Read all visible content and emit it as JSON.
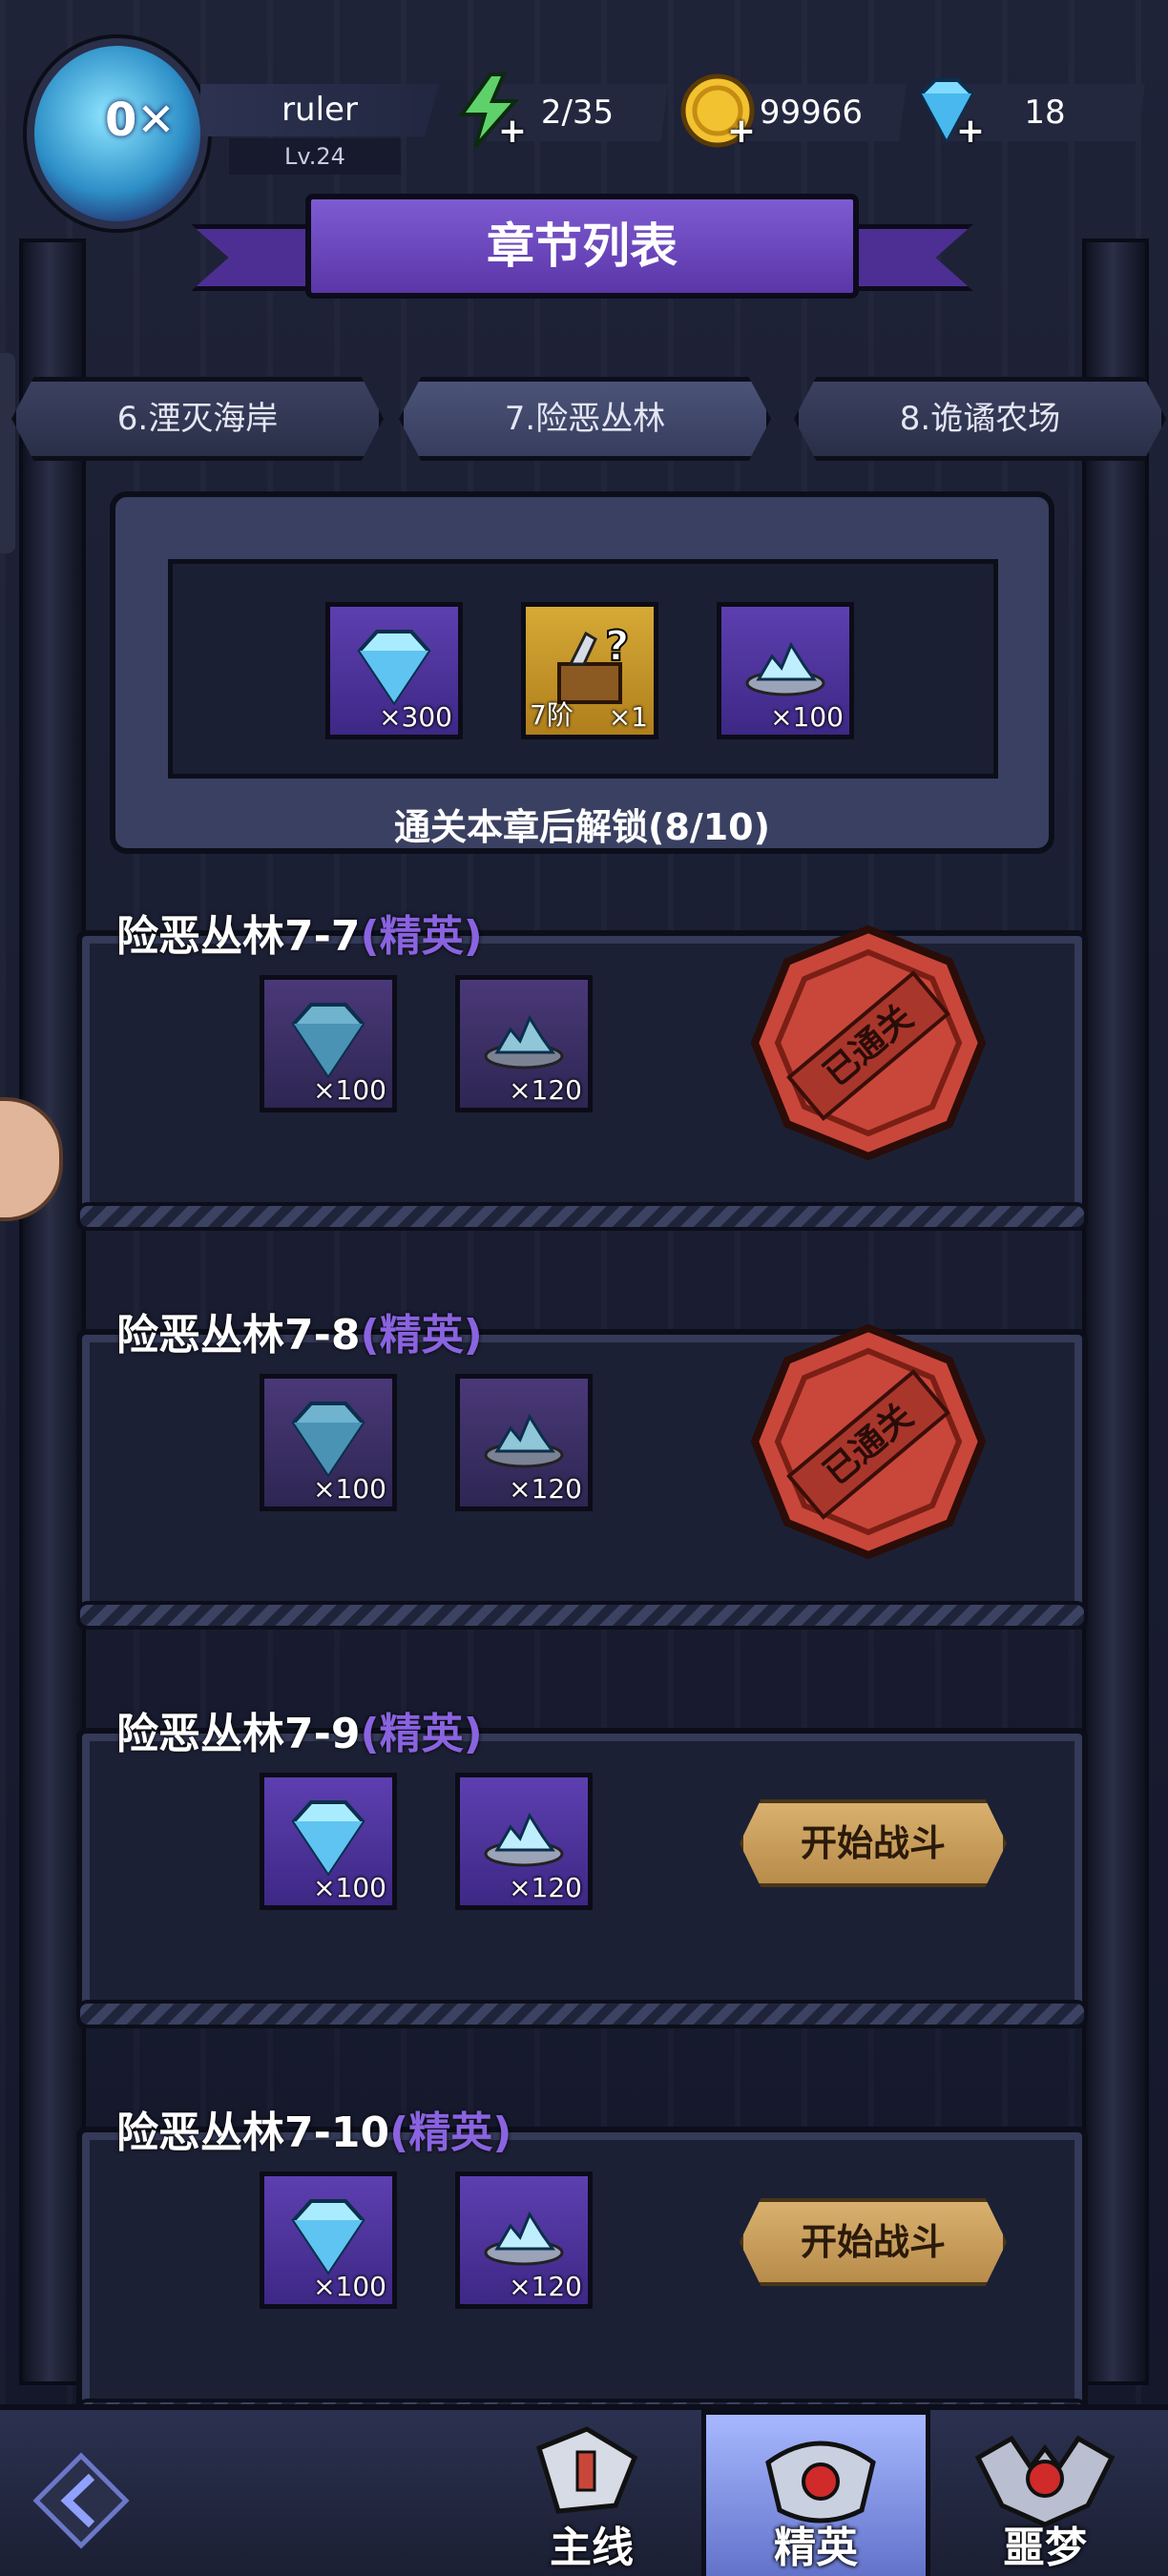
{
  "player": {
    "name": "ruler",
    "level": "Lv.24",
    "avatar_badge": "0✕"
  },
  "resources": {
    "energy": {
      "icon": "lightning-icon",
      "value": "2/35"
    },
    "gold": {
      "icon": "coin-icon",
      "value": "99966"
    },
    "diamond": {
      "icon": "diamond-icon",
      "value": "18"
    }
  },
  "header": {
    "title": "章节列表"
  },
  "chapter_tabs": [
    {
      "label": "6.湮灭海岸"
    },
    {
      "label": "7.险恶丛林"
    },
    {
      "label": "8.诡谲农场"
    }
  ],
  "chapter_reward": {
    "items": [
      {
        "icon": "diamond-icon",
        "count": "×300",
        "tier": ""
      },
      {
        "icon": "mystery-chest-icon",
        "count": "×1",
        "tier": "7阶"
      },
      {
        "icon": "crystal-shards-icon",
        "count": "×100",
        "tier": ""
      }
    ],
    "unlock_text": "通关本章后解锁(8/10)"
  },
  "levels": [
    {
      "name": "险恶丛林7-7",
      "tag": "(精英)",
      "rewards": [
        "×100",
        "×120"
      ],
      "status": "cleared",
      "stamp_text": "已通关"
    },
    {
      "name": "险恶丛林7-8",
      "tag": "(精英)",
      "rewards": [
        "×100",
        "×120"
      ],
      "status": "cleared",
      "stamp_text": "已通关"
    },
    {
      "name": "险恶丛林7-9",
      "tag": "(精英)",
      "rewards": [
        "×100",
        "×120"
      ],
      "status": "available",
      "button": "开始战斗"
    },
    {
      "name": "险恶丛林7-10",
      "tag": "(精英)",
      "rewards": [
        "×100",
        "×120"
      ],
      "status": "available",
      "button": "开始战斗"
    }
  ],
  "bottom_nav": [
    {
      "label": "主线",
      "active": false
    },
    {
      "label": "精英",
      "active": true
    },
    {
      "label": "噩梦",
      "active": false
    }
  ],
  "colors": {
    "elite": "#8a63e0",
    "accent_purple": "#5a36a8",
    "stamp_red": "#c8473a",
    "button_gold": "#d9b06e"
  }
}
